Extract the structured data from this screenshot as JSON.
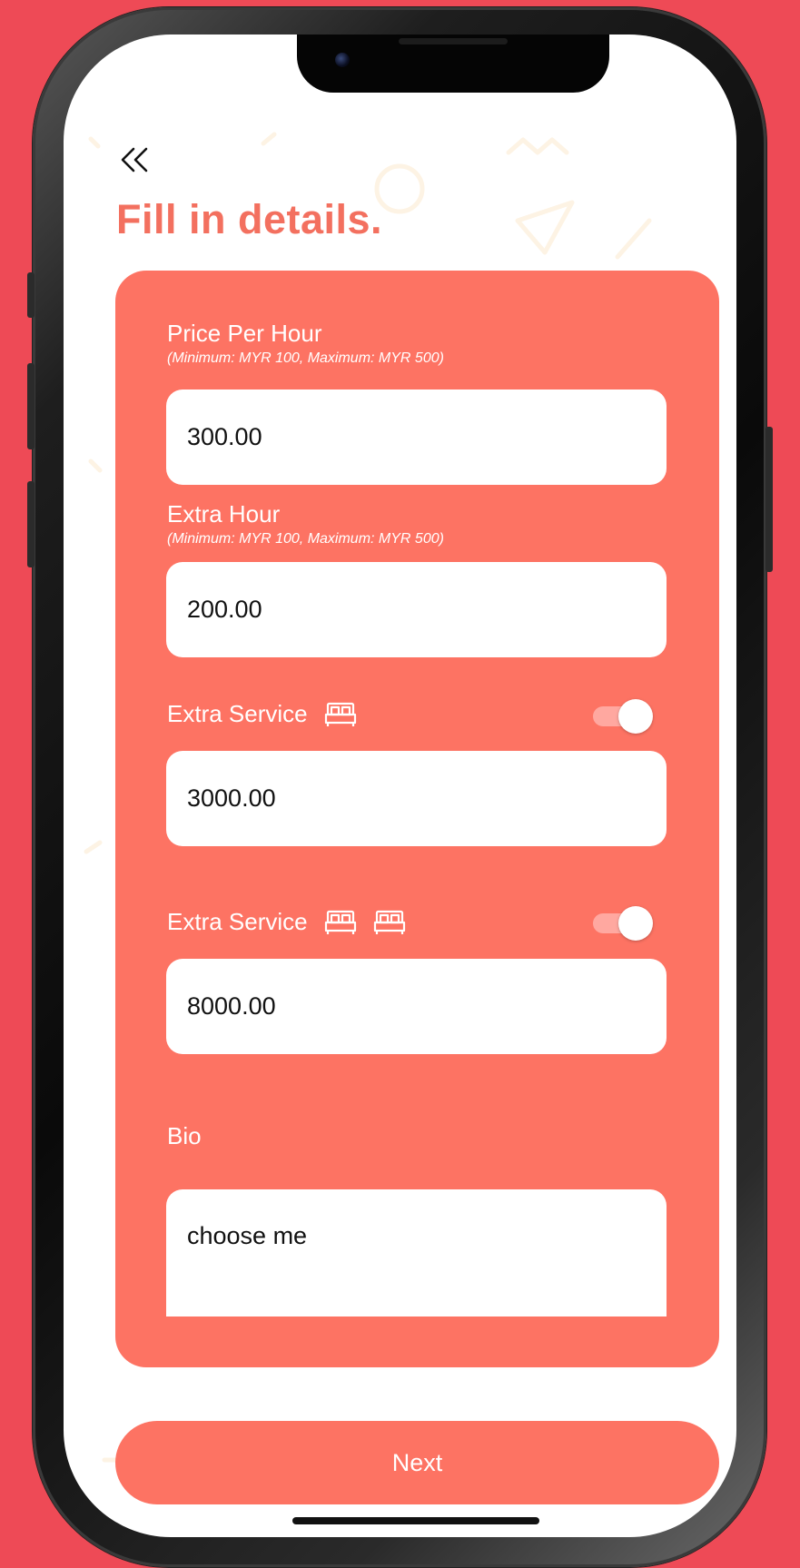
{
  "colors": {
    "background": "#ee4a56",
    "accent": "#fd7363",
    "title": "#f3705f",
    "toggle_track": "#ffa8a0"
  },
  "header": {
    "back_icon": "double-chevron-left-icon",
    "title": "Fill in details."
  },
  "form": {
    "price_per_hour": {
      "label": "Price Per Hour",
      "hint": "(Minimum: MYR 100, Maximum: MYR 500)",
      "value": "300.00"
    },
    "extra_hour": {
      "label": "Extra Hour",
      "hint": "(Minimum: MYR 100, Maximum: MYR 500)",
      "value": "200.00"
    },
    "extra_service_single": {
      "label": "Extra Service",
      "icon": "bed-icon",
      "enabled": true,
      "value": "3000.00"
    },
    "extra_service_double": {
      "label": "Extra Service",
      "icon": "bed-icon",
      "enabled": true,
      "value": "8000.00"
    },
    "bio": {
      "label": "Bio",
      "value": "choose me"
    }
  },
  "footer": {
    "next_label": "Next"
  }
}
